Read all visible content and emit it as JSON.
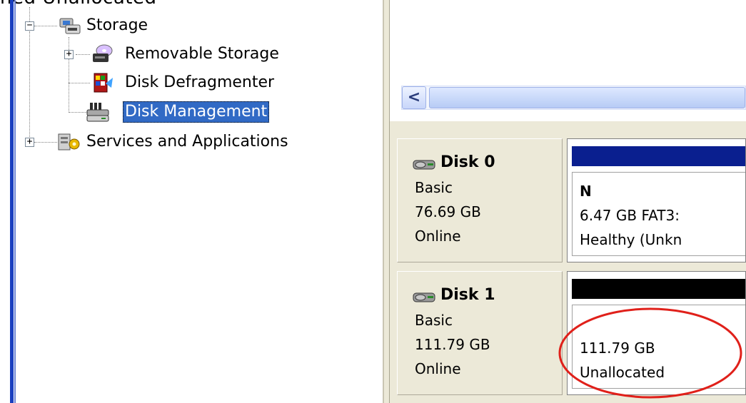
{
  "heading_fragment": "ned  Unallocated \"",
  "tree": {
    "items": [
      {
        "label": "Storage",
        "expander": "−",
        "icon": "storage-icon"
      },
      {
        "label": "Removable Storage",
        "expander": "+",
        "icon": "removable-storage-icon"
      },
      {
        "label": "Disk Defragmenter",
        "expander": "",
        "icon": "disk-defragmenter-icon"
      },
      {
        "label": "Disk Management",
        "expander": "",
        "icon": "disk-management-icon",
        "selected": true
      },
      {
        "label": "Services and Applications",
        "expander": "+",
        "icon": "services-applications-icon"
      }
    ]
  },
  "scrollbar": {
    "left_arrow": "<"
  },
  "disks": [
    {
      "name": "Disk 0",
      "type": "Basic",
      "size": "76.69 GB",
      "status": "Online",
      "bar_color": "#0a1f8f",
      "partition": {
        "title": "N",
        "line1": "6.47 GB FAT3:",
        "line2": "Healthy (Unkn"
      }
    },
    {
      "name": "Disk 1",
      "type": "Basic",
      "size": "111.79 GB",
      "status": "Online",
      "bar_color": "#000000",
      "partition": {
        "title": "",
        "line1": "111.79 GB",
        "line2": "Unallocated"
      }
    }
  ],
  "colors": {
    "selection": "#316ac5",
    "highlight_ellipse": "#e0201a"
  }
}
